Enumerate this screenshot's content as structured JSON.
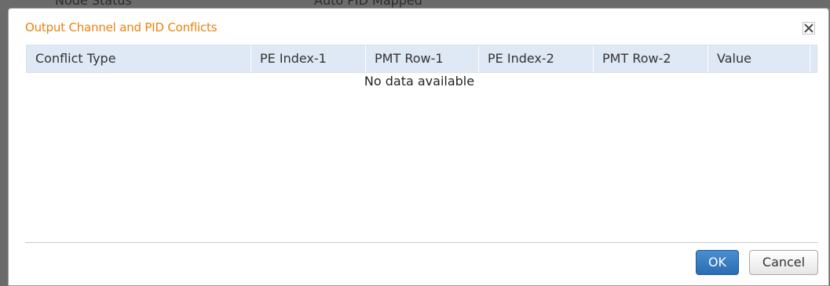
{
  "background": {
    "left_text": "Node Status",
    "right_text": "Auto PID Mapped"
  },
  "dialog": {
    "title": "Output Channel and PID Conflicts",
    "close_icon": "close-x-icon"
  },
  "table": {
    "columns": [
      "Conflict Type",
      "PE Index-1",
      "PMT Row-1",
      "PE Index-2",
      "PMT Row-2",
      "Value"
    ],
    "empty_message": "No data available"
  },
  "buttons": {
    "ok_label": "OK",
    "cancel_label": "Cancel"
  },
  "colors": {
    "title": "#e8820c",
    "header_bg": "#dfe8f5",
    "ok_bg": "#2a6db3"
  }
}
